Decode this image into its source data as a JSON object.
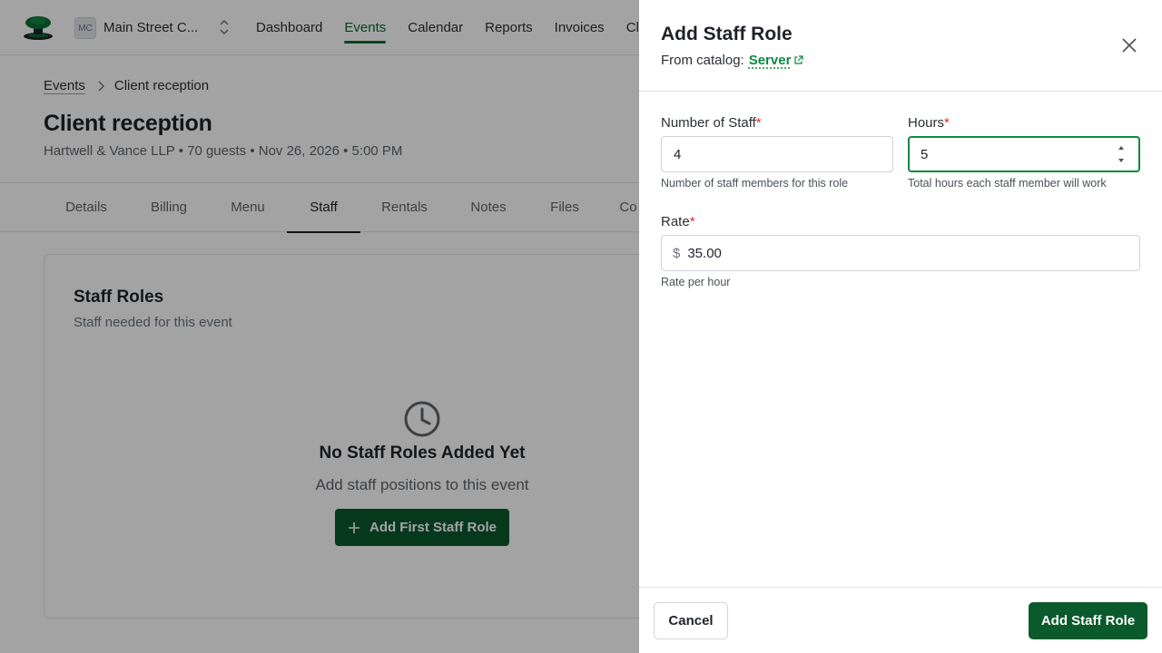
{
  "topbar": {
    "org_initials": "MC",
    "org_name": "Main Street C...",
    "nav": [
      "Dashboard",
      "Events",
      "Calendar",
      "Reports",
      "Invoices",
      "Cl"
    ],
    "active_nav": "Events"
  },
  "breadcrumb": {
    "parent": "Events",
    "current": "Client reception"
  },
  "event": {
    "title": "Client reception",
    "subtitle": "Hartwell & Vance LLP • 70 guests • Nov 26, 2026 • 5:00 PM"
  },
  "tabs": [
    "Details",
    "Billing",
    "Menu",
    "Staff",
    "Rentals",
    "Notes",
    "Files",
    "Co"
  ],
  "active_tab": "Staff",
  "staff_card": {
    "title": "Staff Roles",
    "subtitle": "Staff needed for this event",
    "empty_title": "No Staff Roles Added Yet",
    "empty_subtitle": "Add staff positions to this event",
    "empty_button": "Add First Staff Role"
  },
  "drawer": {
    "title": "Add Staff Role",
    "catalog_prefix": "From catalog:",
    "catalog_item": "Server",
    "fields": {
      "num_staff": {
        "label": "Number of Staff",
        "value": "4",
        "hint": "Number of staff members for this role"
      },
      "hours": {
        "label": "Hours",
        "value": "5",
        "hint": "Total hours each staff member will work"
      },
      "rate": {
        "label": "Rate",
        "prefix": "$",
        "value": "35.00",
        "hint": "Rate per hour"
      }
    },
    "required_marker": "*",
    "cancel_label": "Cancel",
    "submit_label": "Add Staff Role"
  },
  "colors": {
    "brand_green": "#0a5a2b",
    "accent_green": "#0b8a3e",
    "required_red": "#d32f2f"
  },
  "icons": [
    "logo-icon",
    "chevron-updown-icon",
    "chevron-right-icon",
    "clock-icon",
    "plus-icon",
    "external-link-icon",
    "close-icon",
    "spinner-up-icon",
    "spinner-down-icon"
  ]
}
